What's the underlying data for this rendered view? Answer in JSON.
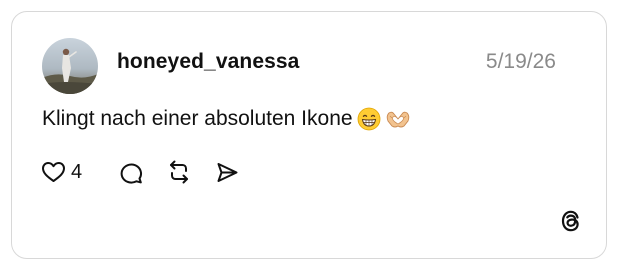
{
  "post": {
    "username": "honeyed_vanessa",
    "date": "5/19/26",
    "text": "Klingt nach einer absoluten Ikone",
    "emojis": [
      "grinning-face-emoji",
      "heart-hands-emoji"
    ],
    "like_count": "4"
  },
  "icons": {
    "like": "heart-icon",
    "reply": "comment-bubble-icon",
    "repost": "repost-arrows-icon",
    "share": "send-icon",
    "brand": "threads-logo-icon"
  },
  "colors": {
    "text": "#111111",
    "muted": "#8a8a8a",
    "border": "#d8d8d8"
  }
}
